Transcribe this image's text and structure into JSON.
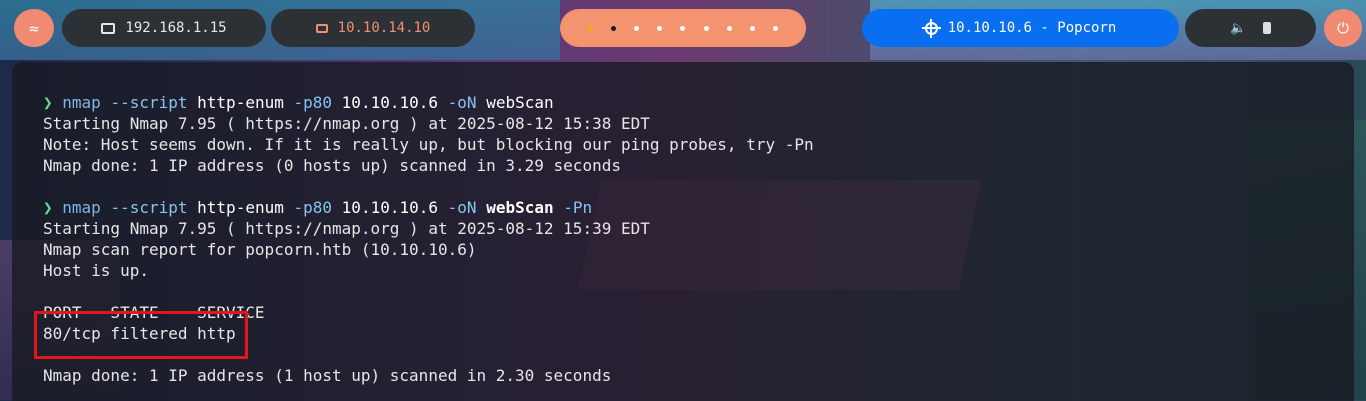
{
  "topbar": {
    "local_ip": "192.168.1.15",
    "vpn_ip": "10.10.14.10",
    "target": "10.10.10.6 - Popcorn",
    "workspaces": 9,
    "colors": {
      "accent": "#f08a73",
      "target_bg": "#0a6ef0",
      "pill_bg": "#2c3136"
    }
  },
  "terminal": {
    "cmd1": {
      "prompt": "❯",
      "program": "nmap",
      "opt1": "--script",
      "opt1_val": "http-enum",
      "opt2": "-p80",
      "target": "10.10.10.6",
      "opt3": "-oN",
      "outfile": "webScan"
    },
    "out1": [
      "Starting Nmap 7.95 ( https://nmap.org ) at 2025-08-12 15:38 EDT",
      "Note: Host seems down. If it is really up, but blocking our ping probes, try -Pn",
      "Nmap done: 1 IP address (0 hosts up) scanned in 3.29 seconds"
    ],
    "cmd2": {
      "prompt": "❯",
      "program": "nmap",
      "opt1": "--script",
      "opt1_val": "http-enum",
      "opt2": "-p80",
      "target": "10.10.10.6",
      "opt3": "-oN",
      "outfile": "webScan",
      "opt4": "-Pn"
    },
    "out2": [
      "Starting Nmap 7.95 ( https://nmap.org ) at 2025-08-12 15:39 EDT",
      "Nmap scan report for popcorn.htb (10.10.10.6)",
      "Host is up."
    ],
    "table_header": "PORT   STATE    SERVICE",
    "table_row": "80/tcp filtered http",
    "done": "Nmap done: 1 IP address (1 host up) scanned in 2.30 seconds"
  }
}
